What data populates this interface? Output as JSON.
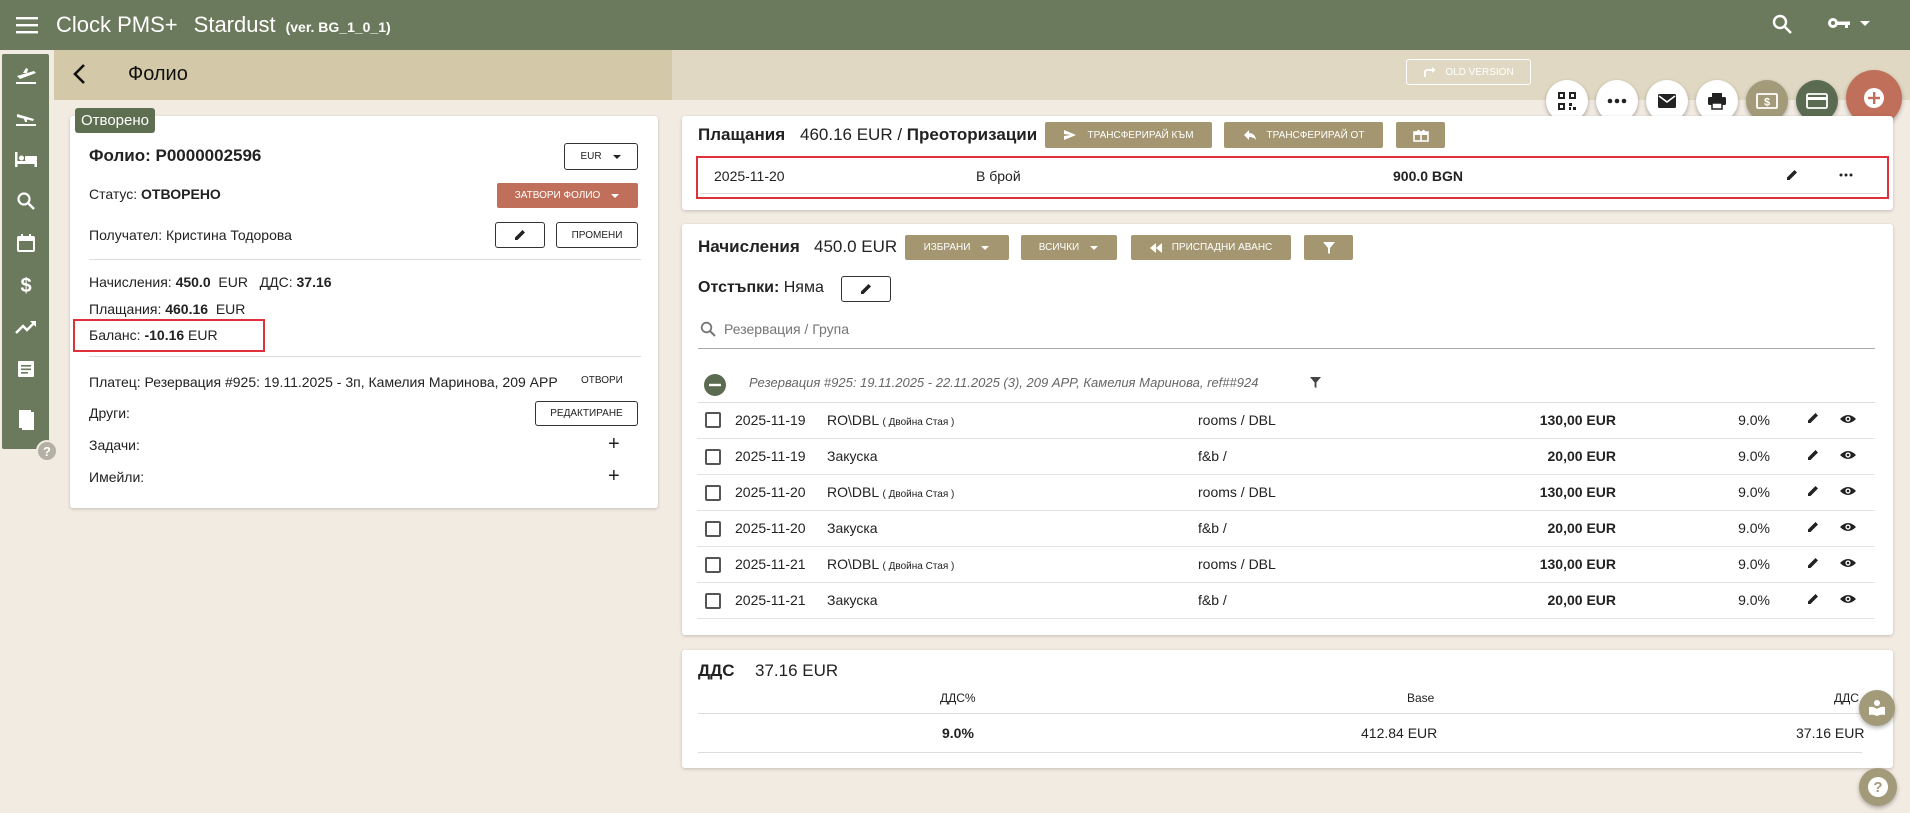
{
  "topbar": {
    "app_title": "Clock PMS+",
    "hotel_name": "Stardust",
    "version": "(ver. BG_1_0_1)"
  },
  "page": {
    "title": "Фолио",
    "status_chip": "Отворено",
    "old_version_label": "OLD VERSION"
  },
  "folio": {
    "number_label": "Фолио: ",
    "number": "P0000002596",
    "currency": "EUR",
    "status_label": "Статус: ",
    "status_value": "ОТВОРЕНО",
    "close_button": "ЗАТВОРИ ФОЛИО",
    "recipient": "Получател: Кристина Тодорова",
    "change_button": "ПРОМЕНИ",
    "charges_label": "Начисления: ",
    "charges_value": "450.0",
    "charges_currency": "EUR",
    "vat_label": "ДДС: ",
    "vat_value": "37.16",
    "payments_label": "Плащания: ",
    "payments_value": "460.16",
    "payments_currency": "EUR",
    "balance_label": "Баланс: ",
    "balance_value": "-10.16",
    "balance_currency": "EUR",
    "payer": "Платец: Резервация #925: 19.11.2025 - 3п, Камелия Маринова, 209 APP",
    "open_link": "ОТВОРИ",
    "others_label": "Други:",
    "edit_button": "РЕДАКТИРАНЕ",
    "tasks_label": "Задачи:",
    "emails_label": "Имейли:"
  },
  "payments": {
    "title": "Плащания",
    "amount": "460.16 EUR /",
    "reauth": "Преоторизации",
    "transfer_to": "ТРАНСФЕРИРАЙ КЪМ",
    "transfer_from": "ТРАНСФЕРИРАЙ ОТ",
    "rows": [
      {
        "date": "2025-11-20",
        "method": "В брой",
        "amount": "900.0 BGN"
      }
    ]
  },
  "charges": {
    "title": "Начисления",
    "amount": "450.0 EUR",
    "selected_button": "ИЗБРАНИ",
    "all_button": "ВСИЧКИ",
    "deduct_button": "ПРИСПАДНИ АВАНС",
    "discounts_label": "Отстъпки: ",
    "discounts_value": "Няма",
    "search_placeholder": "Резервация / Група",
    "group_title": "Резервация #925: 19.11.2025 - 22.11.2025 (3), 209 APP, Камелия Маринова, ref##924",
    "rows": [
      {
        "date": "2025-11-19",
        "name": "RO\\DBL",
        "sub": "( Двойна Стая )",
        "cat": "rooms / DBL",
        "amount": "130,00 EUR",
        "vat": "9.0%"
      },
      {
        "date": "2025-11-19",
        "name": "Закуска",
        "sub": "",
        "cat": "f&b /",
        "amount": "20,00 EUR",
        "vat": "9.0%"
      },
      {
        "date": "2025-11-20",
        "name": "RO\\DBL",
        "sub": "( Двойна Стая )",
        "cat": "rooms / DBL",
        "amount": "130,00 EUR",
        "vat": "9.0%"
      },
      {
        "date": "2025-11-20",
        "name": "Закуска",
        "sub": "",
        "cat": "f&b /",
        "amount": "20,00 EUR",
        "vat": "9.0%"
      },
      {
        "date": "2025-11-21",
        "name": "RO\\DBL",
        "sub": "( Двойна Стая )",
        "cat": "rooms / DBL",
        "amount": "130,00 EUR",
        "vat": "9.0%"
      },
      {
        "date": "2025-11-21",
        "name": "Закуска",
        "sub": "",
        "cat": "f&b /",
        "amount": "20,00 EUR",
        "vat": "9.0%"
      }
    ]
  },
  "vat": {
    "title": "ДДС",
    "amount": "37.16 EUR",
    "col_rate": "ДДС%",
    "col_base": "Base",
    "col_vat": "ДДС",
    "rate": "9.0%",
    "base": "412.84 EUR",
    "value": "37.16 EUR"
  },
  "colors": {
    "olive": "#6b7a5c",
    "tan": "#a39670",
    "red_accent": "#c0705a",
    "highlight": "#e0303a"
  }
}
